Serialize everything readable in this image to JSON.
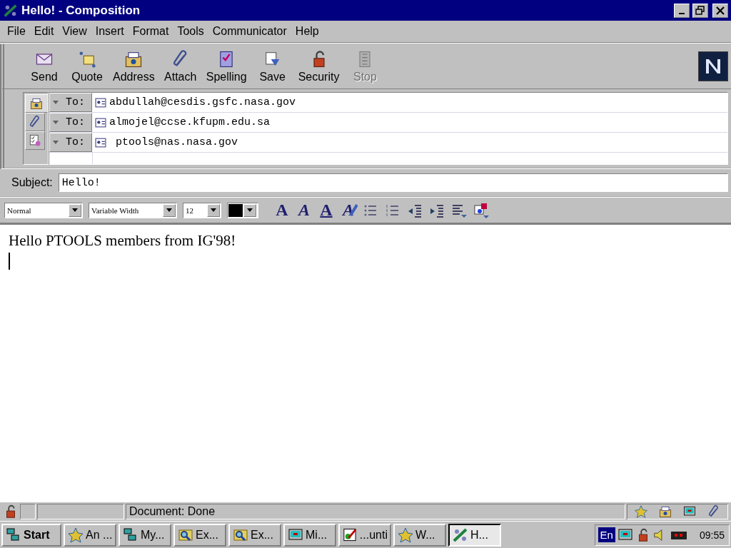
{
  "window": {
    "title": "Hello! - Composition"
  },
  "menu": [
    "File",
    "Edit",
    "View",
    "Insert",
    "Format",
    "Tools",
    "Communicator",
    "Help"
  ],
  "toolbar": [
    {
      "label": "Send",
      "kind": "send",
      "disabled": false
    },
    {
      "label": "Quote",
      "kind": "quote",
      "disabled": false
    },
    {
      "label": "Address",
      "kind": "address",
      "disabled": false
    },
    {
      "label": "Attach",
      "kind": "attach",
      "disabled": false
    },
    {
      "label": "Spelling",
      "kind": "spelling",
      "disabled": false
    },
    {
      "label": "Save",
      "kind": "save",
      "disabled": false
    },
    {
      "label": "Security",
      "kind": "security",
      "disabled": false
    },
    {
      "label": "Stop",
      "kind": "stop",
      "disabled": true
    }
  ],
  "side_tabs": [
    {
      "kind": "address",
      "selected": true
    },
    {
      "kind": "attach",
      "selected": false
    },
    {
      "kind": "options",
      "selected": false
    }
  ],
  "recipients": [
    {
      "type": "To:",
      "address": "abdullah@cesdis.gsfc.nasa.gov"
    },
    {
      "type": "To:",
      "address": "almojel@ccse.kfupm.edu.sa"
    },
    {
      "type": "To:",
      "address": " ptools@nas.nasa.gov"
    }
  ],
  "subject": {
    "label": "Subject:",
    "value": "Hello!"
  },
  "format_bar": {
    "paragraph": "Normal",
    "font": "Variable Width",
    "size": "12",
    "style_buttons": [
      {
        "kind": "bold",
        "glyph": "A"
      },
      {
        "kind": "italic",
        "glyph": "A"
      },
      {
        "kind": "underline",
        "glyph": "A"
      },
      {
        "kind": "clear",
        "glyph": "A"
      }
    ]
  },
  "body": {
    "text": "Hello PTOOLS members from IG'98!"
  },
  "status_bar": {
    "message": "Document: Done"
  },
  "taskbar": {
    "start": "Start",
    "tasks": [
      {
        "label": "An ...",
        "kind": "star",
        "selected": false
      },
      {
        "label": "My...",
        "kind": "computer",
        "selected": false
      },
      {
        "label": "Ex...",
        "kind": "explore",
        "selected": false
      },
      {
        "label": "Ex...",
        "kind": "explore",
        "selected": false
      },
      {
        "label": "Mi...",
        "kind": "monitor",
        "selected": false
      },
      {
        "label": "...unti",
        "kind": "paint",
        "selected": false
      },
      {
        "label": "W...",
        "kind": "star",
        "selected": false
      },
      {
        "label": "H...",
        "kind": "compose",
        "selected": true
      }
    ],
    "language": "En",
    "clock": "09:55"
  }
}
